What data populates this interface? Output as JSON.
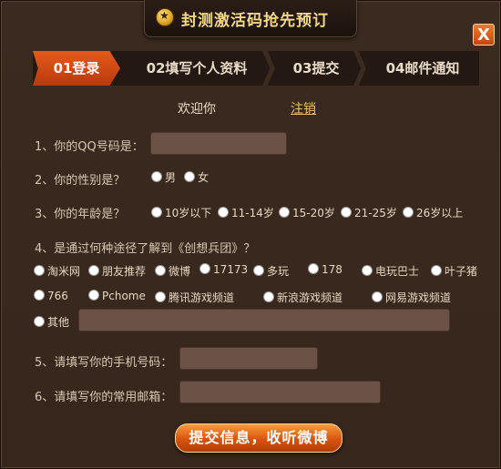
{
  "header": {
    "title": "封测激活码抢先预订",
    "icon": "star-coin-icon"
  },
  "close_label": "X",
  "steps": [
    "01登录",
    "02填写个人资料",
    "03提交",
    "04邮件通知"
  ],
  "welcome": {
    "prefix": "欢迎你",
    "name": "",
    "logout": "注销"
  },
  "questions": {
    "qq": "1、你的QQ号码是：",
    "gender": "2、你的性别是？",
    "age": "3、你的年龄是？",
    "source": "4、是通过何种途径了解到《创想兵团》？",
    "phone": "5、请填写你的手机号码：",
    "email": "6、请填写你的常用邮箱："
  },
  "gender_options": [
    "男",
    "女"
  ],
  "age_options": [
    "10岁以下",
    "11-14岁",
    "15-20岁",
    "21-25岁",
    "26岁以上"
  ],
  "source_options": [
    "淘米网",
    "朋友推荐",
    "微博",
    "17173",
    "多玩",
    "178",
    "电玩巴士",
    "叶子猪",
    "766",
    "Pchome",
    "腾讯游戏频道",
    "新浪游戏频道",
    "网易游戏频道",
    "其他"
  ],
  "submit_label": "提交信息，收听微博",
  "colors": {
    "accent": "#d8540f",
    "background": "#3a2a20",
    "input": "#6b5146"
  }
}
